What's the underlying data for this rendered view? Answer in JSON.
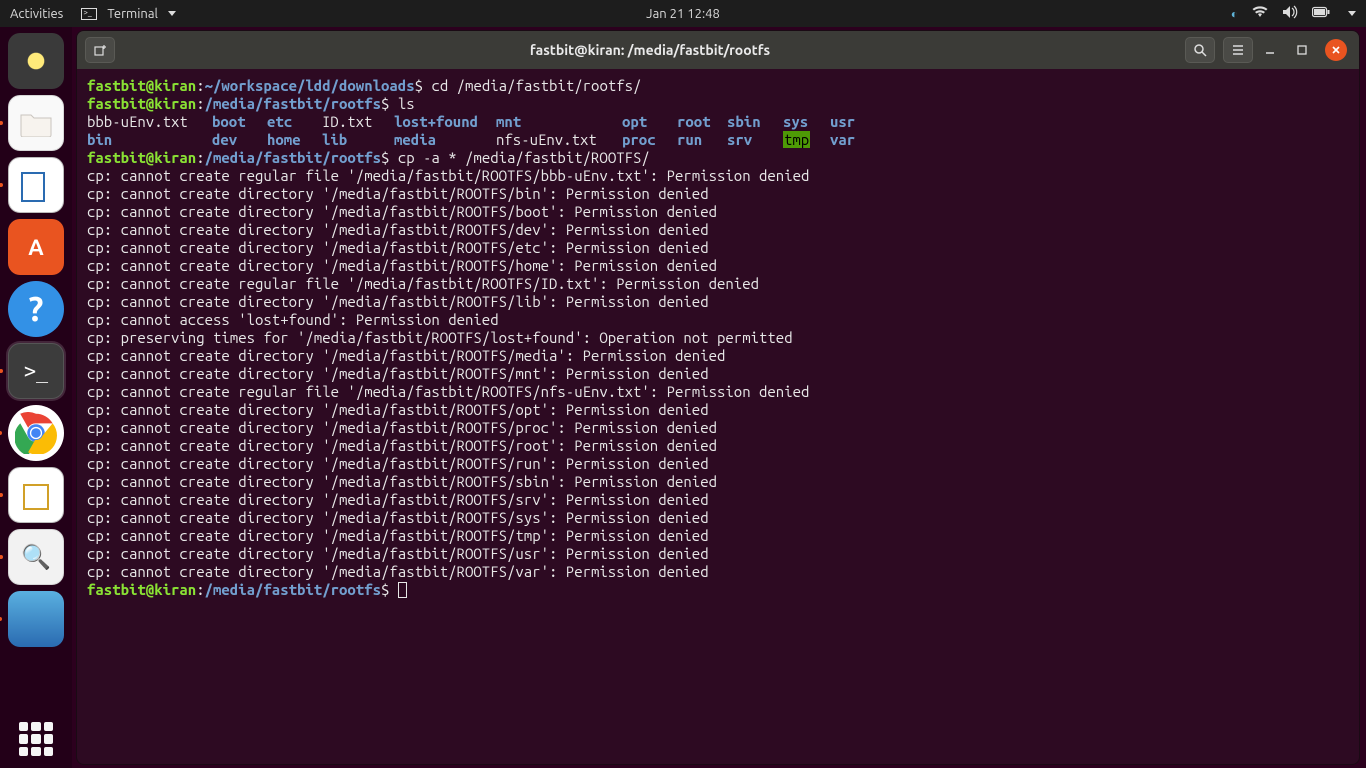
{
  "topbar": {
    "activities": "Activities",
    "app_label": "Terminal",
    "datetime": "Jan 21  12:48"
  },
  "window": {
    "title": "fastbit@kiran: /media/fastbit/rootfs"
  },
  "prompt": {
    "user_host": "fastbit@kiran",
    "path1": "~/workspace/ldd/downloads",
    "path2": "/media/fastbit/rootfs",
    "cmd1": "cd /media/fastbit/rootfs/",
    "cmd2": "ls",
    "cmd3": "cp -a * /media/fastbit/ROOTFS/"
  },
  "ls": {
    "row1": [
      "bbb-uEnv.txt",
      "boot",
      "etc",
      "ID.txt",
      "lost+found",
      "mnt",
      "opt",
      "root",
      "sbin",
      "sys",
      "usr"
    ],
    "row2": [
      "bin",
      "dev",
      "home",
      "lib",
      "media",
      "nfs-uEnv.txt",
      "proc",
      "run",
      "srv",
      "tmp",
      "var"
    ]
  },
  "errors": [
    "cp: cannot create regular file '/media/fastbit/ROOTFS/bbb-uEnv.txt': Permission denied",
    "cp: cannot create directory '/media/fastbit/ROOTFS/bin': Permission denied",
    "cp: cannot create directory '/media/fastbit/ROOTFS/boot': Permission denied",
    "cp: cannot create directory '/media/fastbit/ROOTFS/dev': Permission denied",
    "cp: cannot create directory '/media/fastbit/ROOTFS/etc': Permission denied",
    "cp: cannot create directory '/media/fastbit/ROOTFS/home': Permission denied",
    "cp: cannot create regular file '/media/fastbit/ROOTFS/ID.txt': Permission denied",
    "cp: cannot create directory '/media/fastbit/ROOTFS/lib': Permission denied",
    "cp: cannot access 'lost+found': Permission denied",
    "cp: preserving times for '/media/fastbit/ROOTFS/lost+found': Operation not permitted",
    "cp: cannot create directory '/media/fastbit/ROOTFS/media': Permission denied",
    "cp: cannot create directory '/media/fastbit/ROOTFS/mnt': Permission denied",
    "cp: cannot create regular file '/media/fastbit/ROOTFS/nfs-uEnv.txt': Permission denied",
    "cp: cannot create directory '/media/fastbit/ROOTFS/opt': Permission denied",
    "cp: cannot create directory '/media/fastbit/ROOTFS/proc': Permission denied",
    "cp: cannot create directory '/media/fastbit/ROOTFS/root': Permission denied",
    "cp: cannot create directory '/media/fastbit/ROOTFS/run': Permission denied",
    "cp: cannot create directory '/media/fastbit/ROOTFS/sbin': Permission denied",
    "cp: cannot create directory '/media/fastbit/ROOTFS/srv': Permission denied",
    "cp: cannot create directory '/media/fastbit/ROOTFS/sys': Permission denied",
    "cp: cannot create directory '/media/fastbit/ROOTFS/tmp': Permission denied",
    "cp: cannot create directory '/media/fastbit/ROOTFS/usr': Permission denied",
    "cp: cannot create directory '/media/fastbit/ROOTFS/var': Permission denied"
  ]
}
